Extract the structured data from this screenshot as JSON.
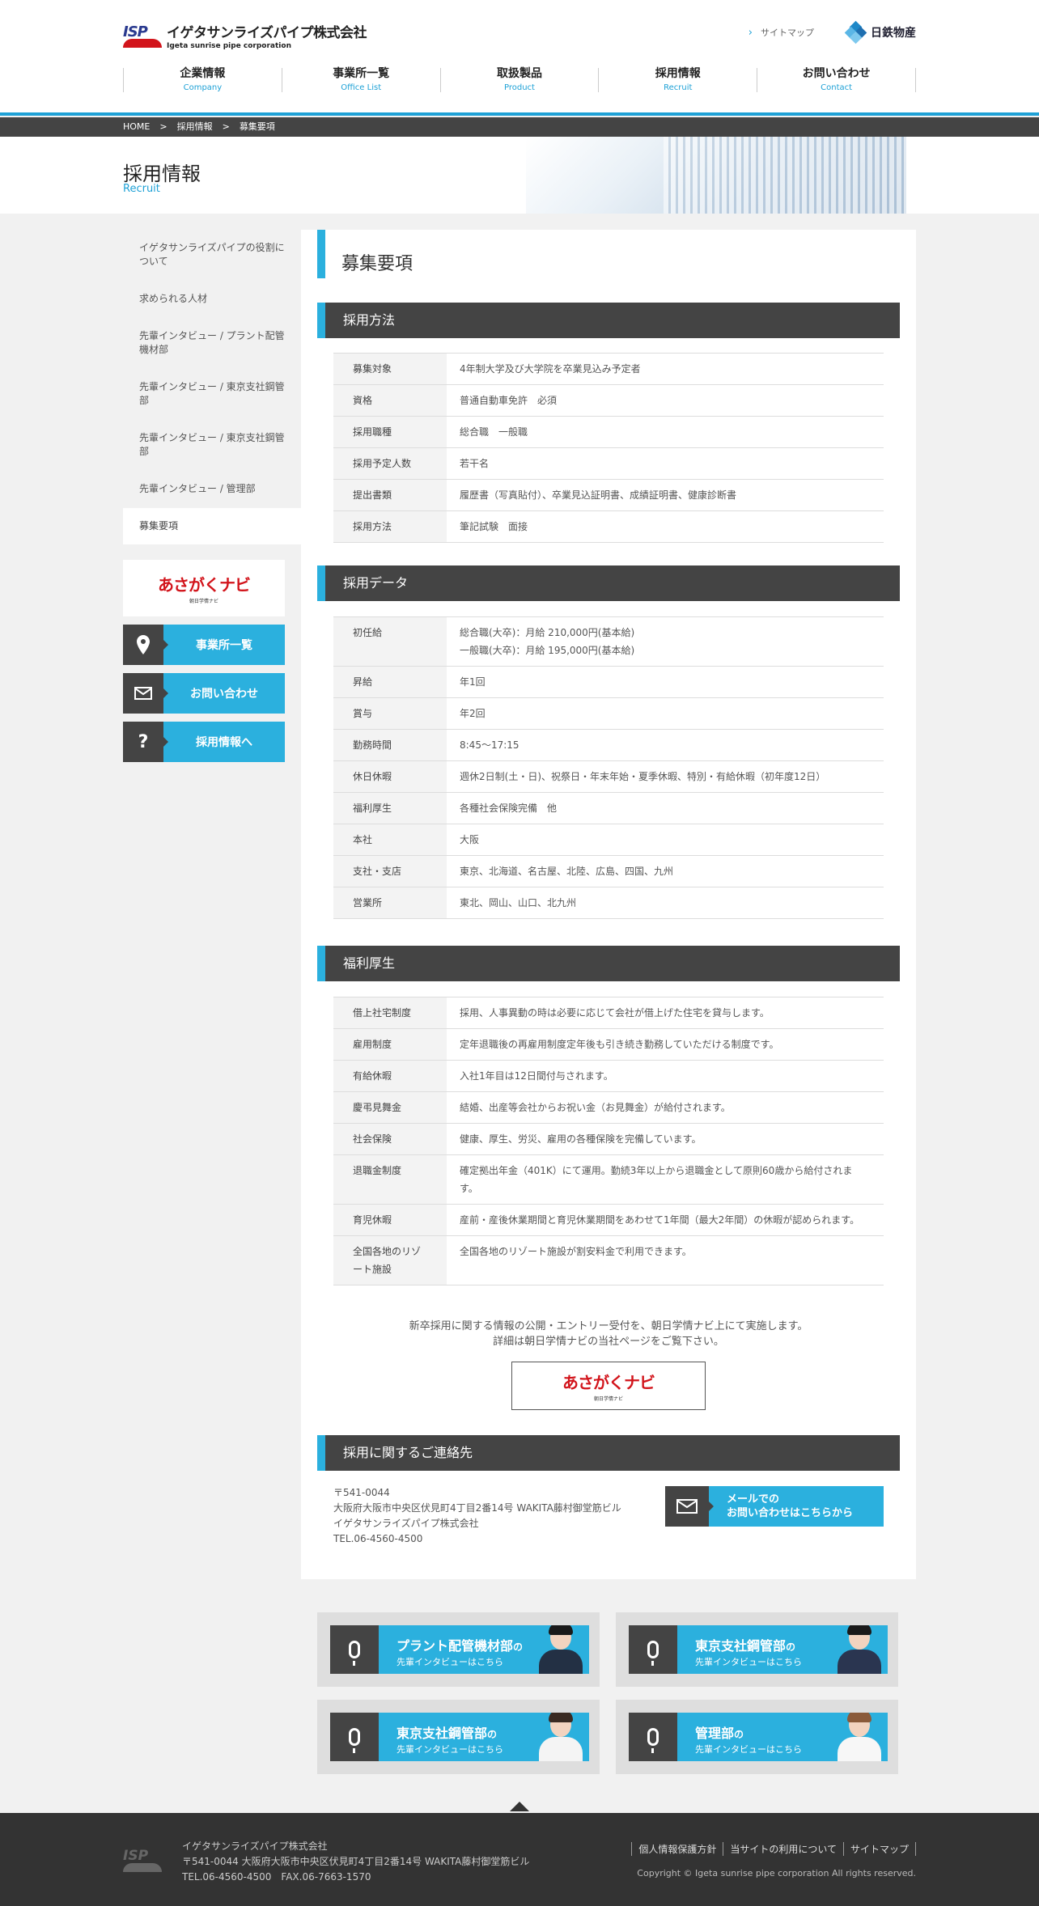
{
  "header": {
    "logo_name_jp": "イゲタサンライズパイプ株式会社",
    "logo_name_en": "Igeta sunrise pipe corporation",
    "logo_mark": "ISP",
    "sitemap": "サイトマップ",
    "partner": "日鉄物産",
    "nav": [
      {
        "jp": "企業情報",
        "en": "Company"
      },
      {
        "jp": "事業所一覧",
        "en": "Office List"
      },
      {
        "jp": "取扱製品",
        "en": "Product"
      },
      {
        "jp": "採用情報",
        "en": "Recruit"
      },
      {
        "jp": "お問い合わせ",
        "en": "Contact"
      }
    ]
  },
  "breadcrumb": {
    "home": "HOME",
    "sep": ">",
    "level1": "採用情報",
    "current": "募集要項"
  },
  "hero": {
    "title": "採用情報",
    "subtitle": "Recruit"
  },
  "sidebar": {
    "items": [
      "イゲタサンライズパイプの役割について",
      "求められる人材",
      "先輩インタビュー / プラント配管機材部",
      "先輩インタビュー / 東京支社鋼管部",
      "先輩インタビュー / 東京支社鋼管部",
      "先輩インタビュー / 管理部",
      "募集要項"
    ],
    "asa_logo": "あさがくナビ",
    "asa_sub": "朝日学情ナビ",
    "buttons": [
      "事業所一覧",
      "お問い合わせ",
      "採用情報へ"
    ],
    "colors": {
      "accent": "#2bb0de",
      "dark": "#444444"
    }
  },
  "main": {
    "page_title": "募集要項",
    "sections": {
      "method": "採用方法",
      "data": "採用データ",
      "welfare": "福利厚生",
      "contact": "採用に関するご連絡先"
    },
    "method_rows": [
      {
        "k": "募集対象",
        "v": "4年制大学及び大学院を卒業見込み予定者"
      },
      {
        "k": "資格",
        "v": "普通自動車免許　必須"
      },
      {
        "k": "採用職種",
        "v": "総合職　一般職"
      },
      {
        "k": "採用予定人数",
        "v": "若干名"
      },
      {
        "k": "提出書類",
        "v": "履歴書（写真貼付）、卒業見込証明書、成績証明書、健康診断書"
      },
      {
        "k": "採用方法",
        "v": "筆記試験　面接"
      }
    ],
    "data_rows": [
      {
        "k": "初任給",
        "v": "総合職(大卒)：月給 210,000円(基本給)",
        "v2": "一般職(大卒)：月給 195,000円(基本給)"
      },
      {
        "k": "昇給",
        "v": "年1回"
      },
      {
        "k": "賞与",
        "v": "年2回"
      },
      {
        "k": "勤務時間",
        "v": "8:45～17:15"
      },
      {
        "k": "休日休暇",
        "v": "週休2日制(土・日)、祝祭日・年末年始・夏季休暇、特別・有給休暇（初年度12日）"
      },
      {
        "k": "福利厚生",
        "v": "各種社会保険完備　他"
      },
      {
        "k": "本社",
        "v": "大阪"
      },
      {
        "k": "支社・支店",
        "v": "東京、北海道、名古屋、北陸、広島、四国、九州"
      },
      {
        "k": "営業所",
        "v": "東北、岡山、山口、北九州"
      }
    ],
    "welfare_rows": [
      {
        "k": "借上社宅制度",
        "v": "採用、人事異動の時は必要に応じて会社が借上げた住宅を貸与します。"
      },
      {
        "k": "雇用制度",
        "v": "定年退職後の再雇用制度定年後も引き続き勤務していただける制度です。"
      },
      {
        "k": "有給休暇",
        "v": "入社1年目は12日間付与されます。"
      },
      {
        "k": "慶弔見舞金",
        "v": "結婚、出産等会社からお祝い金（お見舞金）が給付されます。"
      },
      {
        "k": "社会保険",
        "v": "健康、厚生、労災、雇用の各種保険を完備しています。"
      },
      {
        "k": "退職金制度",
        "v": "確定拠出年金（401K）にて運用。勤続3年以上から退職金として原則60歳から給付されます。"
      },
      {
        "k": "育児休暇",
        "v": "産前・産後休業期間と育児休業期間をあわせて1年間（最大2年間）の休暇が認められます。"
      },
      {
        "k": "全国各地のリゾート施設",
        "v": "全国各地のリゾート施設が割安料金で利用できます。"
      }
    ],
    "note_line1": "新卒採用に関する情報の公開・エントリー受付を、朝日学情ナビ上にて実施します。",
    "note_line2": "詳細は朝日学情ナビの当社ページをご覧下さい。",
    "contact": {
      "zip": "〒541-0044",
      "address": "大阪府大阪市中央区伏見町4丁目2番14号 WAKITA藤村御堂筋ビル",
      "company": "イゲタサンライズパイプ株式会社",
      "tel": "TEL.06-4560-4500",
      "mail_btn_1": "メールでの",
      "mail_btn_2": "お問い合わせはこちらから"
    }
  },
  "interviews": [
    {
      "dept": "プラント配管機材部",
      "suffix": "の",
      "line2": "先輩インタビューはこちら"
    },
    {
      "dept": "東京支社鋼管部",
      "suffix": "の",
      "line2": "先輩インタビューはこちら"
    },
    {
      "dept": "東京支社鋼管部",
      "suffix": "の",
      "line2": "先輩インタビューはこちら"
    },
    {
      "dept": "管理部",
      "suffix": "の",
      "line2": "先輩インタビューはこちら"
    }
  ],
  "footer": {
    "company": "イゲタサンライズパイプ株式会社",
    "address": "〒541-0044 大阪府大阪市中央区伏見町4丁目2番14号 WAKITA藤村御堂筋ビル",
    "tel_fax": "TEL.06-4560-4500　FAX.06-7663-1570",
    "links": [
      "個人情報保護方針",
      "当サイトの利用について",
      "サイトマップ"
    ],
    "copyright": "Copyright © Igeta sunrise pipe corporation All rights reserved."
  }
}
